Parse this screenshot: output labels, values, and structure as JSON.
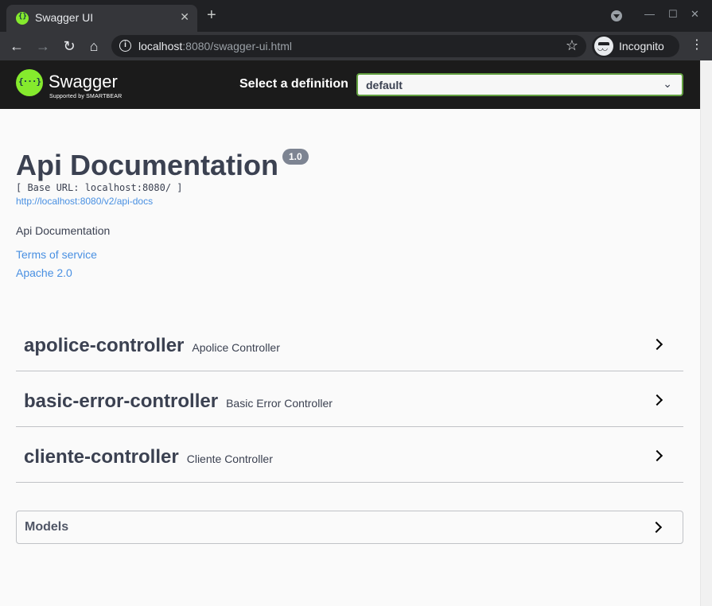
{
  "browser": {
    "tab_title": "Swagger UI",
    "url_host": "localhost",
    "url_rest": ":8080/swagger-ui.html",
    "profile_label": "Incognito"
  },
  "topbar": {
    "logo_text": "Swagger",
    "logo_sub": "Supported by SMARTBEAR",
    "definition_label": "Select a definition",
    "definition_value": "default",
    "brand_color": "#85ea2d",
    "select_border_color": "#62a03f"
  },
  "info": {
    "title": "Api Documentation",
    "version": "1.0",
    "base_url": "[ Base URL: localhost:8080/ ]",
    "api_docs_link": "http://localhost:8080/v2/api-docs",
    "description": "Api Documentation",
    "terms_link": "Terms of service",
    "license_link": "Apache 2.0",
    "link_color": "#4990e2"
  },
  "controllers": [
    {
      "name": "apolice-controller",
      "description": "Apolice Controller"
    },
    {
      "name": "basic-error-controller",
      "description": "Basic Error Controller"
    },
    {
      "name": "cliente-controller",
      "description": "Cliente Controller"
    }
  ],
  "models": {
    "label": "Models"
  }
}
